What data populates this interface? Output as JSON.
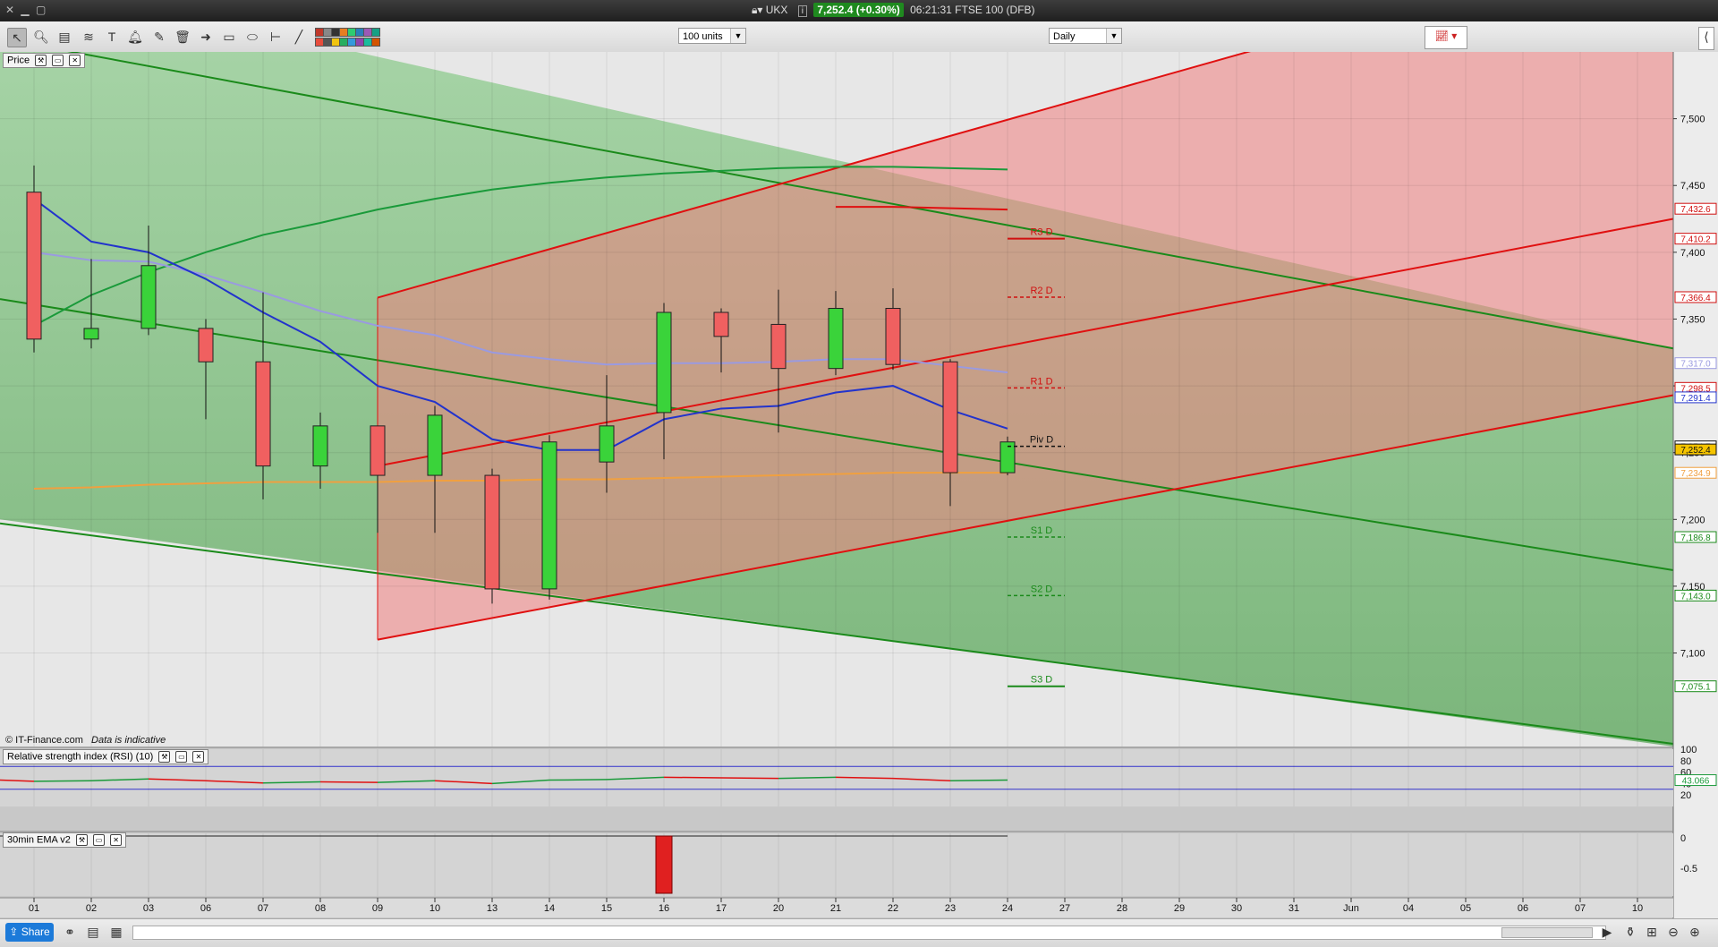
{
  "titlebar": {
    "symbol": "UKX",
    "price_change": "7,252.4 (+0.30%)",
    "time_instrument": "06:21:31 FTSE 100 (DFB)"
  },
  "toolbar": {
    "units_select": "100 units",
    "period_select": "Daily",
    "swatch_colors": [
      "#c0392b",
      "#e74c3c",
      "#888888",
      "#555555",
      "#333333",
      "#f1c40f",
      "#e67e22",
      "#27ae60",
      "#2ecc71",
      "#3498db",
      "#2980b9",
      "#8e44ad",
      "#9b59b6",
      "#1abc9c",
      "#16a085",
      "#d35400"
    ]
  },
  "panels": {
    "price_title": "Price",
    "rsi_title": "Relative strength index (RSI) (10)",
    "ema_title": "30min EMA v2"
  },
  "footer": {
    "copyright": "© IT-Finance.com",
    "disclaimer": "Data is indicative",
    "share_label": "Share"
  },
  "chart_data": {
    "type": "candlestick",
    "x_labels": [
      "01",
      "02",
      "03",
      "06",
      "07",
      "08",
      "09",
      "10",
      "13",
      "14",
      "15",
      "16",
      "17",
      "20",
      "21",
      "22",
      "23",
      "24",
      "27",
      "28",
      "29",
      "30",
      "31",
      "Jun",
      "04",
      "05",
      "06",
      "07",
      "10"
    ],
    "ylim": [
      7030,
      7550
    ],
    "y_ticks": [
      "7,500",
      "7,450",
      "7,400",
      "7,350",
      "7,300",
      "7,250",
      "7,200",
      "7,150",
      "7,100"
    ],
    "y_tick_values": [
      7500,
      7450,
      7400,
      7350,
      7300,
      7250,
      7200,
      7150,
      7100
    ],
    "candles": [
      {
        "o": 7445,
        "h": 7465,
        "l": 7325,
        "c": 7335
      },
      {
        "o": 7335,
        "h": 7395,
        "l": 7328,
        "c": 7343
      },
      {
        "o": 7343,
        "h": 7420,
        "l": 7338,
        "c": 7390
      },
      {
        "o": 7343,
        "h": 7350,
        "l": 7275,
        "c": 7318
      },
      {
        "o": 7318,
        "h": 7370,
        "l": 7215,
        "c": 7240
      },
      {
        "o": 7240,
        "h": 7280,
        "l": 7223,
        "c": 7270
      },
      {
        "o": 7270,
        "h": 7270,
        "l": 7190,
        "c": 7233
      },
      {
        "o": 7233,
        "h": 7285,
        "l": 7190,
        "c": 7278
      },
      {
        "o": 7233,
        "h": 7238,
        "l": 7137,
        "c": 7148
      },
      {
        "o": 7148,
        "h": 7263,
        "l": 7140,
        "c": 7258
      },
      {
        "o": 7243,
        "h": 7308,
        "l": 7220,
        "c": 7270
      },
      {
        "o": 7280,
        "h": 7362,
        "l": 7245,
        "c": 7355
      },
      {
        "o": 7355,
        "h": 7358,
        "l": 7310,
        "c": 7337
      },
      {
        "o": 7346,
        "h": 7372,
        "l": 7265,
        "c": 7313
      },
      {
        "o": 7313,
        "h": 7371,
        "l": 7308,
        "c": 7358
      },
      {
        "o": 7358,
        "h": 7373,
        "l": 7312,
        "c": 7316
      },
      {
        "o": 7318,
        "h": 7320,
        "l": 7210,
        "c": 7235
      },
      {
        "o": 7235,
        "h": 7262,
        "l": 7233,
        "c": 7258
      }
    ],
    "pivot_levels": [
      {
        "label": "R3 D",
        "value": 7410.2,
        "color": "#d01010",
        "dashed": false
      },
      {
        "label": "R2 D",
        "value": 7366.4,
        "color": "#d01010",
        "dashed": true
      },
      {
        "label": "R1 D",
        "value": 7298.5,
        "color": "#d01010",
        "dashed": true
      },
      {
        "label": "Piv D",
        "value": 7254.7,
        "color": "#111111",
        "dashed": true
      },
      {
        "label": "S1 D",
        "value": 7186.8,
        "color": "#1a8a1a",
        "dashed": true
      },
      {
        "label": "S2 D",
        "value": 7143.0,
        "color": "#1a8a1a",
        "dashed": true
      },
      {
        "label": "S3 D",
        "value": 7075.1,
        "color": "#1a8a1a",
        "dashed": false
      }
    ],
    "price_tags": [
      {
        "label": "7,432.6",
        "value": 7432.6,
        "color": "#d01010"
      },
      {
        "label": "7,410.2",
        "value": 7410.2,
        "color": "#d01010"
      },
      {
        "label": "7,366.4",
        "value": 7366.4,
        "color": "#d01010"
      },
      {
        "label": "7,317.0",
        "value": 7317.0,
        "color": "#9a9ae0"
      },
      {
        "label": "7,298.5",
        "value": 7298.5,
        "color": "#d01010"
      },
      {
        "label": "7,291.4",
        "value": 7291.4,
        "color": "#2233cc"
      },
      {
        "label": "7,254.7",
        "value": 7254.7,
        "color": "#111111"
      },
      {
        "label": "7,252.4",
        "value": 7252.4,
        "color": "#111111",
        "bg": "#f5c400"
      },
      {
        "label": "7,234.9",
        "value": 7234.9,
        "color": "#f0a040"
      },
      {
        "label": "7,186.8",
        "value": 7186.8,
        "color": "#1a8a1a"
      },
      {
        "label": "7,143.0",
        "value": 7143.0,
        "color": "#1a8a1a"
      },
      {
        "label": "7,075.1",
        "value": 7075.1,
        "color": "#1a8a1a"
      }
    ],
    "ma_blue": [
      7440,
      7408,
      7400,
      7380,
      7355,
      7333,
      7300,
      7288,
      7260,
      7252,
      7252,
      7275,
      7283,
      7285,
      7295,
      7300,
      7282,
      7268
    ],
    "ma_lavender": [
      7400,
      7394,
      7393,
      7383,
      7370,
      7356,
      7345,
      7338,
      7325,
      7320,
      7316,
      7317,
      7317,
      7318,
      7320,
      7320,
      7315,
      7310
    ],
    "ma_orange": [
      7223,
      7224,
      7226,
      7227,
      7228,
      7228,
      7228,
      7229,
      7229,
      7230,
      7230,
      7231,
      7232,
      7233,
      7234,
      7235,
      7235,
      7235
    ],
    "ma_green": [
      7345,
      7368,
      7385,
      7400,
      7413,
      7422,
      7432,
      7440,
      7447,
      7452,
      7456,
      7459,
      7461,
      7463,
      7464,
      7464,
      7463,
      7462
    ],
    "rsi": {
      "values": [
        46,
        44,
        45,
        48,
        45,
        41,
        43,
        42,
        45,
        40,
        46,
        47,
        51,
        50,
        49,
        51,
        49,
        45,
        46
      ],
      "ylim": [
        0,
        100
      ],
      "y_ticks": [
        "100",
        "80",
        "60",
        "40",
        "20"
      ],
      "y_tick_values": [
        100,
        80,
        60,
        40,
        20
      ],
      "upper": 70,
      "lower": 30,
      "current_label": "43.066"
    },
    "ema_panel": {
      "y_ticks": [
        "0",
        "-0.5"
      ],
      "bar_index": 11
    }
  }
}
